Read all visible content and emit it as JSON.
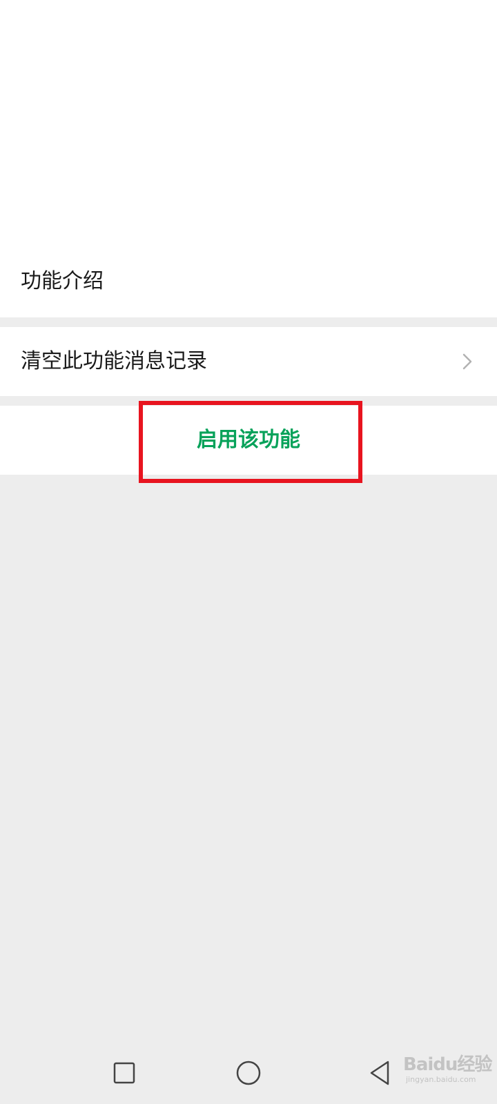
{
  "settings": {
    "intro_label": "功能介绍",
    "clear_label": "清空此功能消息记录",
    "enable_label": "启用该功能"
  },
  "nav": {
    "recent_icon": "square-icon",
    "home_icon": "circle-icon",
    "back_icon": "triangle-back-icon"
  },
  "watermark": {
    "logo_text": "Baidu经验",
    "sub_text": "jingyan.baidu.com"
  },
  "colors": {
    "accent_green": "#07a25a",
    "highlight_red": "#e8141f",
    "page_background": "#ededed"
  }
}
